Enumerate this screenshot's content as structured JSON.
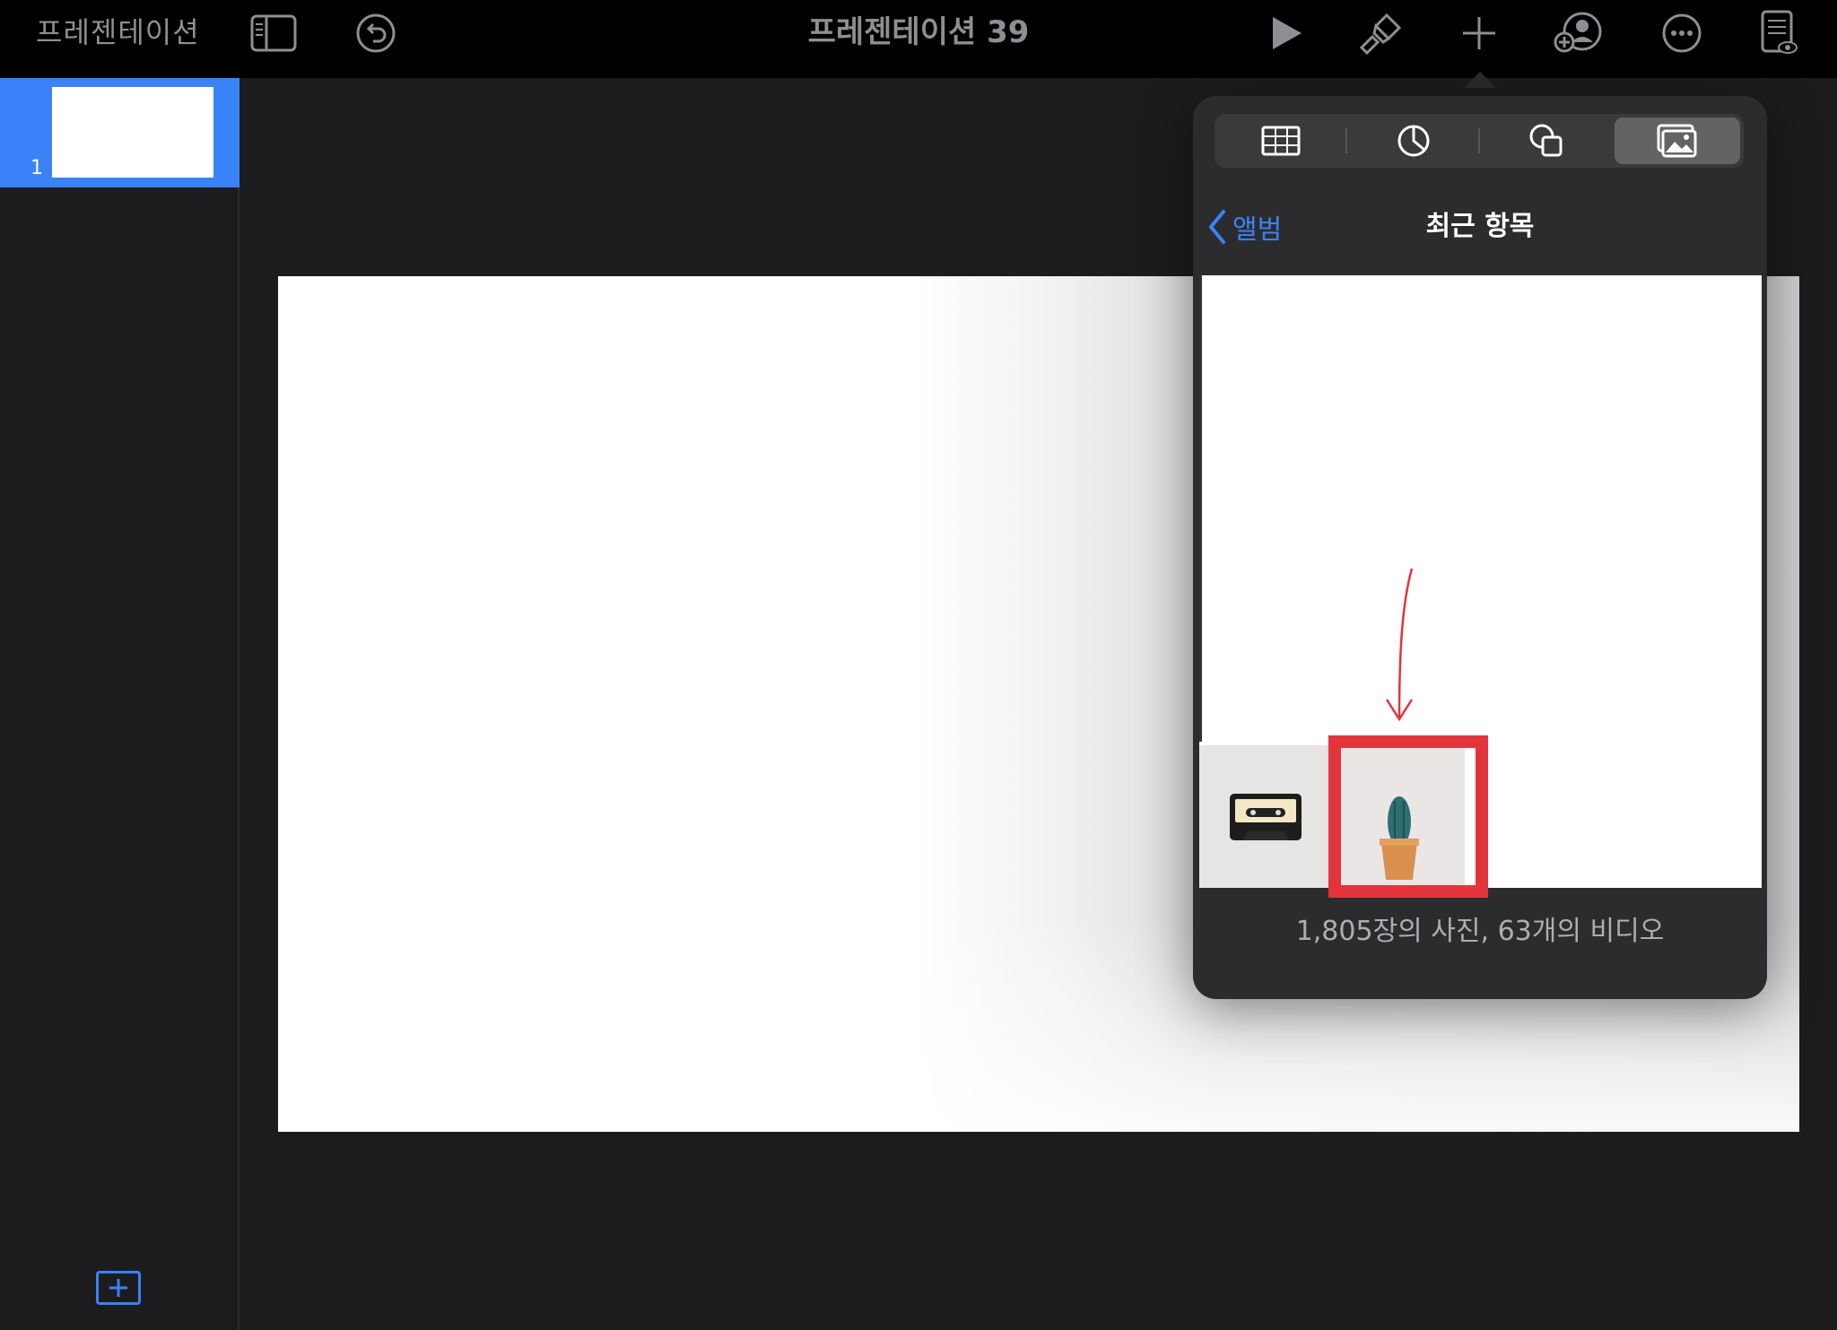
{
  "toolbar": {
    "back_label": "프레젠테이션",
    "title": "프레젠테이션 39",
    "icons": [
      "sidebar-toggle-icon",
      "undo-icon",
      "play-icon",
      "format-brush-icon",
      "plus-icon",
      "collaborate-icon",
      "more-icon",
      "presenter-notes-icon"
    ]
  },
  "slides": {
    "items": [
      {
        "number": "1"
      }
    ]
  },
  "popover": {
    "segments": [
      "table-icon",
      "chart-icon",
      "shapes-icon",
      "media-icon"
    ],
    "back_label": "앨범",
    "title": "최근 항목",
    "footer": "1,805장의 사진, 63개의 비디오"
  },
  "colors": {
    "accent": "#3a82f7",
    "highlight": "#e3343c",
    "toolbar_bg": "#000000",
    "popover_bg": "#2c2c2e"
  }
}
